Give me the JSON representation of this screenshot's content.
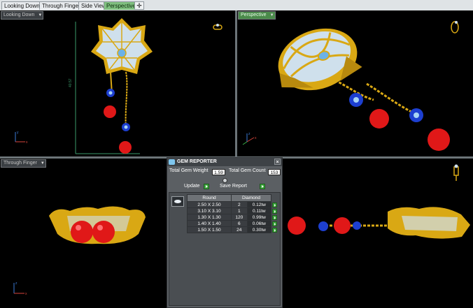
{
  "tabs": [
    {
      "label": "Looking Down"
    },
    {
      "label": "Through Finger"
    },
    {
      "label": "Side View"
    },
    {
      "label": "Perspective"
    }
  ],
  "add_tab_glyph": "✛",
  "viewports": {
    "top_left": {
      "label": "Looking Down",
      "dimension": "40.57"
    },
    "top_right": {
      "label": "Perspective"
    },
    "bottom_left": {
      "label": "Through Finger"
    }
  },
  "axis_labels": {
    "x": "x",
    "y": "y",
    "z": "z"
  },
  "gem_reporter": {
    "title": "GEM REPORTER",
    "close_glyph": "×",
    "total_weight_label": "Total Gem Weight",
    "total_weight_value": "1.59",
    "total_count_label": "Total Gem Count",
    "total_count_value": "153",
    "update_label": "Update",
    "save_label": "Save Report",
    "columns": [
      "Round",
      "Diamond"
    ],
    "rows": [
      {
        "size": "2.50 X 2.50",
        "count": "2",
        "weight": "0.12tw"
      },
      {
        "size": "3.10 X 3.10",
        "count": "1",
        "weight": "0.11tw"
      },
      {
        "size": "1.30 X 1.30",
        "count": "120",
        "weight": "0.99tw"
      },
      {
        "size": "1.40 X 1.40",
        "count": "6",
        "weight": "0.06tw"
      },
      {
        "size": "1.50 X 1.50",
        "count": "24",
        "weight": "0.30tw"
      }
    ]
  },
  "colors": {
    "gold": "#d9a814",
    "ruby": "#e01818",
    "sapphire": "#1d3fd0",
    "diamond": "#cfe0ec",
    "tab_active": "#7fbf7f"
  }
}
